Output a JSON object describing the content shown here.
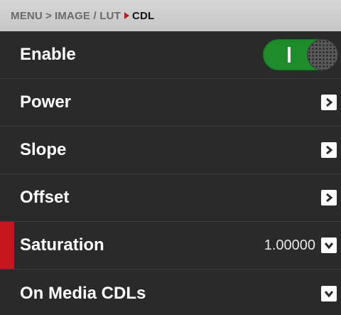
{
  "breadcrumb": {
    "menu": "MENU",
    "separator": ">",
    "section": "IMAGE / LUT",
    "current": "CDL"
  },
  "rows": [
    {
      "label": "Enable",
      "control": "toggle",
      "toggle_state": "on"
    },
    {
      "label": "Power",
      "control": "arrow-right"
    },
    {
      "label": "Slope",
      "control": "arrow-right"
    },
    {
      "label": "Offset",
      "control": "arrow-right"
    },
    {
      "label": "Saturation",
      "control": "dropdown",
      "value": "1.00000",
      "selected": true
    },
    {
      "label": "On Media CDLs",
      "control": "dropdown"
    }
  ],
  "colors": {
    "background": "#2a2a2a",
    "breadcrumb_bg": "#cfcfcf",
    "accent_red": "#c8141c",
    "toggle_green": "#1e8c2a",
    "text": "#ffffff"
  },
  "icons": {
    "breadcrumb_arrow": "chevron-right-icon",
    "row_arrow": "chevron-right-icon",
    "dropdown": "chevron-down-icon"
  }
}
